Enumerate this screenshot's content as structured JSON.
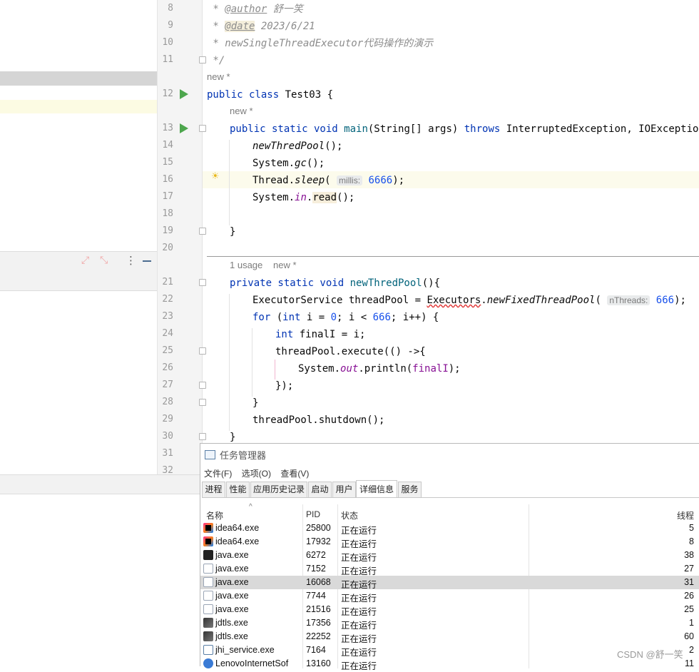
{
  "editor": {
    "lines": [
      {
        "n": "8"
      },
      {
        "n": "9"
      },
      {
        "n": "10"
      },
      {
        "n": "11"
      },
      {
        "n": "12"
      },
      {
        "n": "13"
      },
      {
        "n": "14"
      },
      {
        "n": "15"
      },
      {
        "n": "16"
      },
      {
        "n": "17"
      },
      {
        "n": "18"
      },
      {
        "n": "19"
      },
      {
        "n": "20"
      },
      {
        "n": "21"
      },
      {
        "n": "22"
      },
      {
        "n": "23"
      },
      {
        "n": "24"
      },
      {
        "n": "25"
      },
      {
        "n": "26"
      },
      {
        "n": "27"
      },
      {
        "n": "28"
      },
      {
        "n": "29"
      },
      {
        "n": "30"
      },
      {
        "n": "31"
      },
      {
        "n": "32"
      }
    ],
    "doc_author_tag": "@author",
    "doc_author_val": " 舒一笑",
    "doc_date_tag": "@date",
    "doc_date_val": " 2023/6/21",
    "doc_desc": " * newSingleThreadExecutor代码操作的演示",
    "doc_end": " */",
    "hint_new_class": "new *",
    "class_decl": "Test03",
    "hint_new_main": "new *",
    "main_sig_1": "main",
    "main_sig_2": "(String[] args) ",
    "main_throws": "throws",
    "main_sig_3": " InterruptedException, IOException {",
    "call_new_pool": "newThredPool",
    "sys_gc_1": "System.",
    "sys_gc_2": "gc",
    "thread_sleep_1": "Thread.",
    "thread_sleep_2": "sleep",
    "hint_millis": "millis:",
    "sleep_value": "6666",
    "sys_read_1": "System.",
    "sys_read_in": "in",
    "sys_read_2": "read",
    "close_brace_main": "}",
    "hint_usage": "1 usage",
    "hint_usage_new": "new *",
    "method_name": "newThredPool",
    "exec_decl_1": "ExecutorService threadPool = ",
    "exec_decl_cls": "Executors",
    "exec_decl_m": "newFixedThreadPool",
    "hint_nthreads": "nThreads:",
    "pool_size": "666",
    "for_limit": "666",
    "final_var": "finalI",
    "exec_call": "threadPool.execute(() ->{",
    "println_1": "System.",
    "println_out": "out",
    "println_2": ".println(",
    "shutdown": "threadPool.shutdown();",
    "close_brace_method": "}"
  },
  "task_manager": {
    "title": "任务管理器",
    "menu": [
      "文件(F)",
      "选项(O)",
      "查看(V)"
    ],
    "tabs": [
      "进程",
      "性能",
      "应用历史记录",
      "启动",
      "用户",
      "详细信息",
      "服务"
    ],
    "active_tab": "详细信息",
    "columns": [
      "名称",
      "PID",
      "状态",
      "线程"
    ],
    "rows": [
      {
        "name": "idea64.exe",
        "pid": "25800",
        "status": "正在运行",
        "threads": "5",
        "icon": "intellij-icon"
      },
      {
        "name": "idea64.exe",
        "pid": "17932",
        "status": "正在运行",
        "threads": "8",
        "icon": "intellij-icon"
      },
      {
        "name": "java.exe",
        "pid": "6272",
        "status": "正在运行",
        "threads": "38",
        "icon": "jetbrains-java-icon"
      },
      {
        "name": "java.exe",
        "pid": "7152",
        "status": "正在运行",
        "threads": "27",
        "icon": "java-icon"
      },
      {
        "name": "java.exe",
        "pid": "16068",
        "status": "正在运行",
        "threads": "31",
        "icon": "java-icon",
        "selected": true
      },
      {
        "name": "java.exe",
        "pid": "7744",
        "status": "正在运行",
        "threads": "26",
        "icon": "java-icon"
      },
      {
        "name": "java.exe",
        "pid": "21516",
        "status": "正在运行",
        "threads": "25",
        "icon": "java-icon"
      },
      {
        "name": "jdtls.exe",
        "pid": "17356",
        "status": "正在运行",
        "threads": "1",
        "icon": "jdtls-icon"
      },
      {
        "name": "jdtls.exe",
        "pid": "22252",
        "status": "正在运行",
        "threads": "60",
        "icon": "jdtls-icon"
      },
      {
        "name": "jhi_service.exe",
        "pid": "7164",
        "status": "正在运行",
        "threads": "2",
        "icon": "service-icon"
      },
      {
        "name": "LenovoInternetSof",
        "pid": "13160",
        "status": "正在运行",
        "threads": "11",
        "icon": "lenovo-icon"
      }
    ]
  },
  "watermark": "CSDN @舒一笑"
}
